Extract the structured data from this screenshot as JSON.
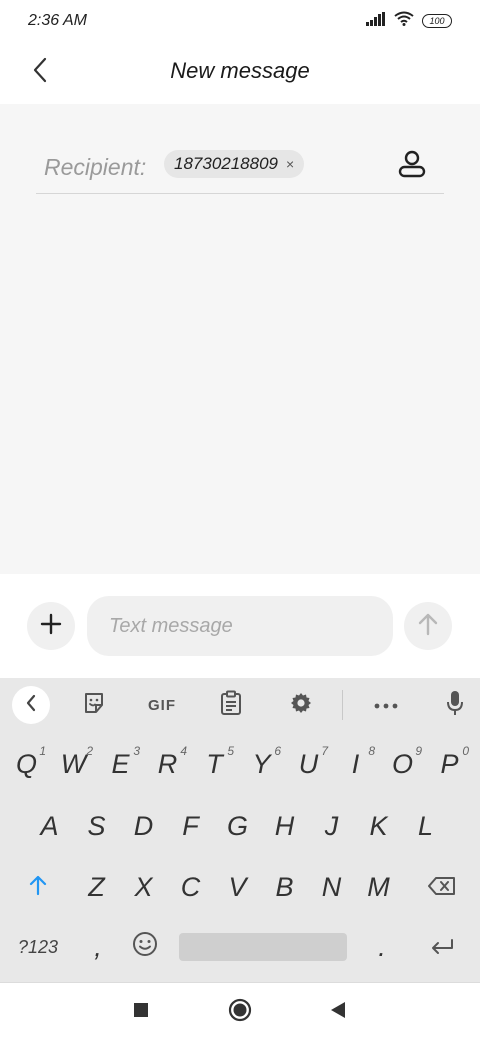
{
  "status_bar": {
    "time": "2:36 AM",
    "battery": "100"
  },
  "app_bar": {
    "title": "New message"
  },
  "recipient": {
    "label": "Recipient:",
    "chip": "18730218809",
    "chip_remove": "×"
  },
  "compose": {
    "placeholder": "Text message"
  },
  "toolbar": {
    "gif_label": "GIF"
  },
  "keyboard": {
    "row1": [
      {
        "key": "Q",
        "hint": "1"
      },
      {
        "key": "W",
        "hint": "2"
      },
      {
        "key": "E",
        "hint": "3"
      },
      {
        "key": "R",
        "hint": "4"
      },
      {
        "key": "T",
        "hint": "5"
      },
      {
        "key": "Y",
        "hint": "6"
      },
      {
        "key": "U",
        "hint": "7"
      },
      {
        "key": "I",
        "hint": "8"
      },
      {
        "key": "O",
        "hint": "9"
      },
      {
        "key": "P",
        "hint": "0"
      }
    ],
    "row2": [
      "A",
      "S",
      "D",
      "F",
      "G",
      "H",
      "J",
      "K",
      "L"
    ],
    "row3": [
      "Z",
      "X",
      "C",
      "V",
      "B",
      "N",
      "M"
    ],
    "symbols_label": "?123",
    "comma": ",",
    "period": "."
  },
  "colors": {
    "accent": "#2196f3",
    "background": "#f6f6f6",
    "keyboard": "#e8e8e8"
  }
}
